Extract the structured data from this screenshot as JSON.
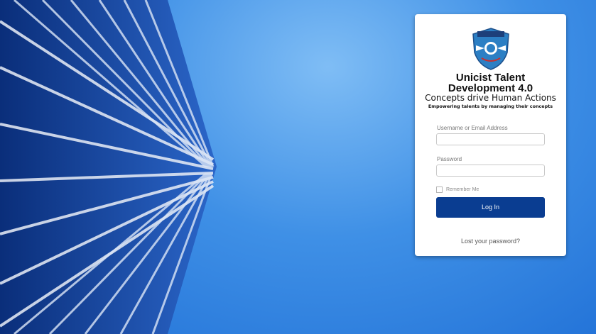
{
  "login": {
    "title_line1": "Unicist Talent",
    "title_line2": "Development 4.0",
    "subtitle": "Concepts drive Human Actions",
    "tagline": "Empowering talents by managing their concepts",
    "username_label": "Username or Email Address",
    "username_value": "",
    "password_label": "Password",
    "password_value": "",
    "remember_label": "Remember Me",
    "remember_checked": false,
    "login_button": "Log In",
    "lost_password": "Lost your password?"
  },
  "colors": {
    "button": "#0a3d91",
    "background": "#3f90e6"
  },
  "icons": {
    "logo": "eagle-shield-logo"
  }
}
